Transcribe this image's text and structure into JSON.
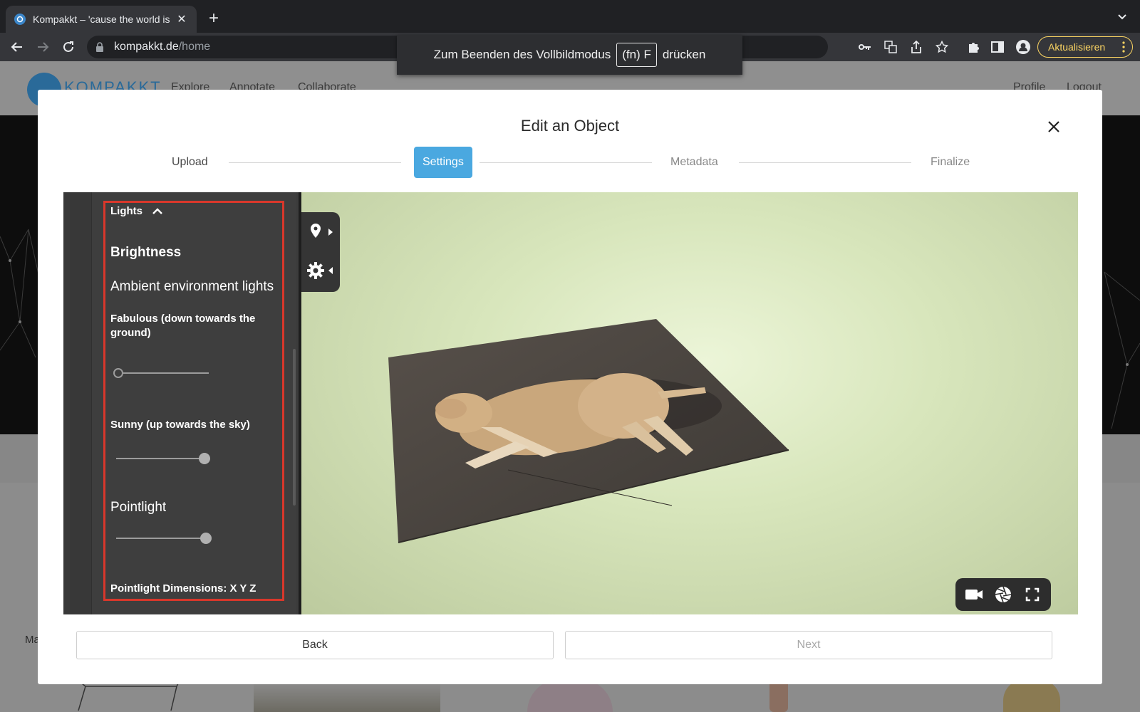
{
  "browser": {
    "tab_title": "Kompakkt – 'cause the world is",
    "new_tab_icon": "plus-icon",
    "url_host": "kompakkt.de",
    "url_path": "/home",
    "update_label": "Aktualisieren"
  },
  "fullscreen_hint": {
    "before": "Zum Beenden des Vollbildmodus",
    "key": "(fn) F",
    "after": "drücken"
  },
  "page": {
    "nav": [
      "Explore",
      "Annotate",
      "Collaborate"
    ],
    "nav_right": [
      "Profile",
      "Logout"
    ],
    "logo_text": "KOMPAKKT",
    "lower_text": "Ma"
  },
  "modal": {
    "title": "Edit an Object",
    "steps": [
      {
        "label": "Upload",
        "state": "done"
      },
      {
        "label": "Settings",
        "state": "active"
      },
      {
        "label": "Metadata",
        "state": "todo"
      },
      {
        "label": "Finalize",
        "state": "todo"
      }
    ],
    "back_label": "Back",
    "next_label": "Next"
  },
  "settings": {
    "section_label": "Lights",
    "brightness_heading": "Brightness",
    "ambient_heading": "Ambient environment lights",
    "fabulous_label": "Fabulous (down towards the ground)",
    "fabulous_value": 0.0,
    "sunny_label": "Sunny (up towards the sky)",
    "sunny_value": 1.0,
    "pointlight_label": "Pointlight",
    "pointlight_value": 1.0,
    "pointlight_dims_label": "Pointlight Dimensions: X Y Z"
  },
  "colors": {
    "accent": "#4aa8e0",
    "highlight": "#d9372b",
    "update": "#fdd663"
  }
}
